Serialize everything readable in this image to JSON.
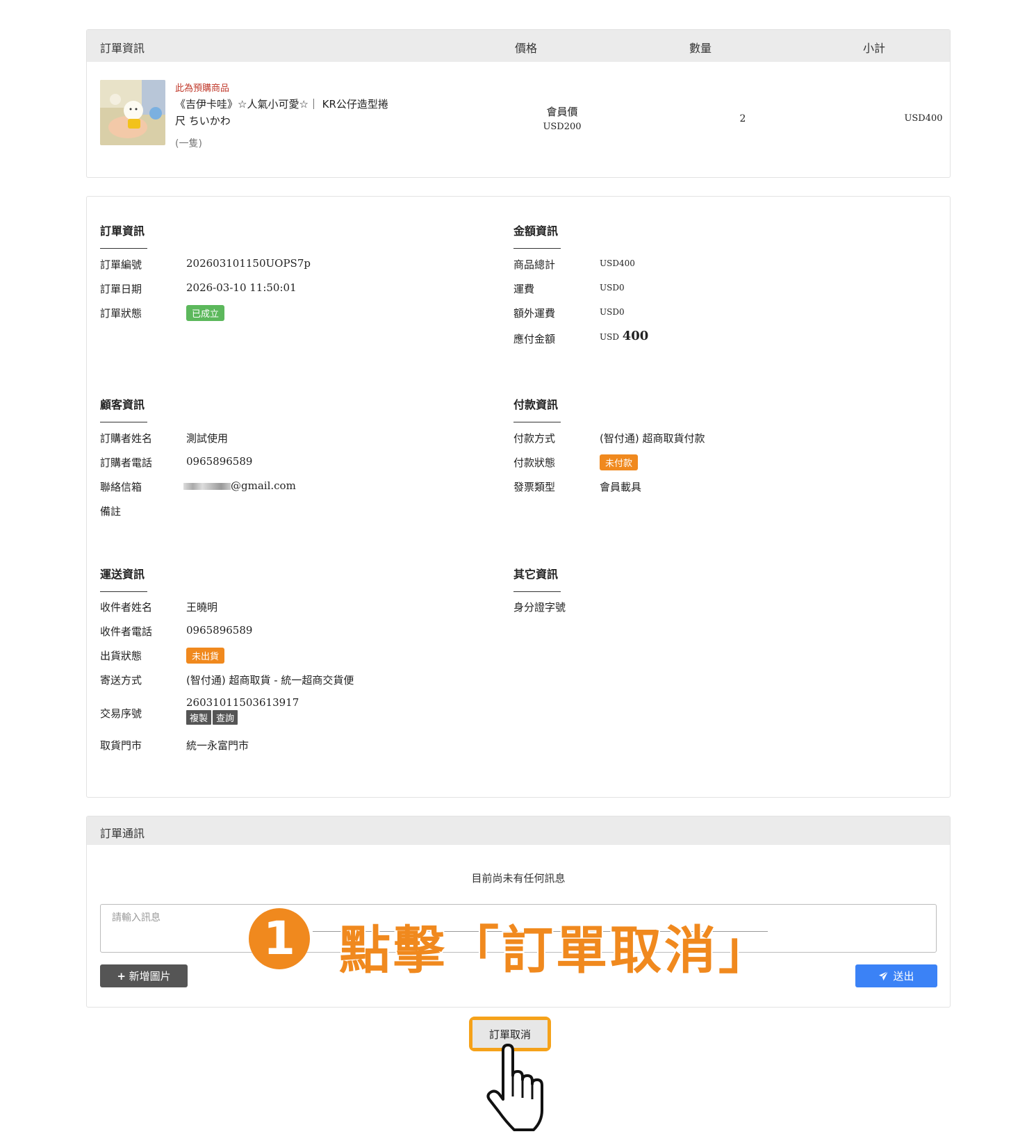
{
  "product_table": {
    "headers": [
      "訂單資訊",
      "價格",
      "數量",
      "小計"
    ],
    "item": {
      "preorder_tag": "此為預購商品",
      "name_line1": "《吉伊卡哇》☆人氣小可愛☆｜ KR公仔造型捲",
      "name_line2": "尺 ちいかわ",
      "spec": "(一隻)",
      "price_label": "會員價",
      "price": "USD200",
      "quantity": "2",
      "subtotal": "USD400"
    }
  },
  "order_info": {
    "title": "訂單資訊",
    "rows": [
      {
        "k": "訂單編號",
        "v": "202603101150UOPS7p"
      },
      {
        "k": "訂單日期",
        "v": "2026-03-10 11:50:01"
      },
      {
        "k": "訂單狀態",
        "v": "已成立"
      }
    ]
  },
  "amount_info": {
    "title": "金額資訊",
    "rows": [
      {
        "k": "商品總計",
        "v": "USD400"
      },
      {
        "k": "運費",
        "v": "USD0"
      },
      {
        "k": "額外運費",
        "v": "USD0"
      },
      {
        "k": "應付金額",
        "v_prefix": "USD",
        "v": "400"
      }
    ]
  },
  "customer_info": {
    "title": "顧客資訊",
    "rows": [
      {
        "k": "訂購者姓名",
        "v": "測試使用"
      },
      {
        "k": "訂購者電話",
        "v": "0965896589"
      },
      {
        "k": "聯絡信箱",
        "v": "@gmail.com"
      },
      {
        "k": "備註",
        "v": ""
      }
    ]
  },
  "payment_info": {
    "title": "付款資訊",
    "rows": [
      {
        "k": "付款方式",
        "v": "(智付通) 超商取貨付款"
      },
      {
        "k": "付款狀態",
        "v": "未付款"
      },
      {
        "k": "發票類型",
        "v": "會員載具"
      }
    ]
  },
  "shipping_info": {
    "title": "運送資訊",
    "rows": [
      {
        "k": "收件者姓名",
        "v": "王曉明"
      },
      {
        "k": "收件者電話",
        "v": "0965896589"
      },
      {
        "k": "出貨狀態",
        "v": "未出貨"
      },
      {
        "k": "寄送方式",
        "v": "(智付通) 超商取貨 - 統一超商交貨便"
      },
      {
        "k": "交易序號",
        "v": "26031011503613917",
        "copy": "複製",
        "query": "查詢"
      },
      {
        "k": "取貨門市",
        "v": "統一永富門市"
      }
    ]
  },
  "other_info": {
    "title": "其它資訊",
    "rows": [
      {
        "k": "身分證字號",
        "v": ""
      }
    ]
  },
  "messages": {
    "title": "訂單通訊",
    "empty_text": "目前尚未有任何訊息",
    "input_placeholder": "請輸入訊息",
    "add_image_label": "新增圖片",
    "send_label": "送出"
  },
  "annotation": {
    "step_number": "1",
    "text": "點擊「訂單取消」"
  },
  "cancel_button_label": "訂單取消",
  "colors": {
    "accent_orange": "#f0891e",
    "status_green": "#5cb85c",
    "send_blue": "#3b82f6",
    "preorder_red": "#c0392b"
  }
}
